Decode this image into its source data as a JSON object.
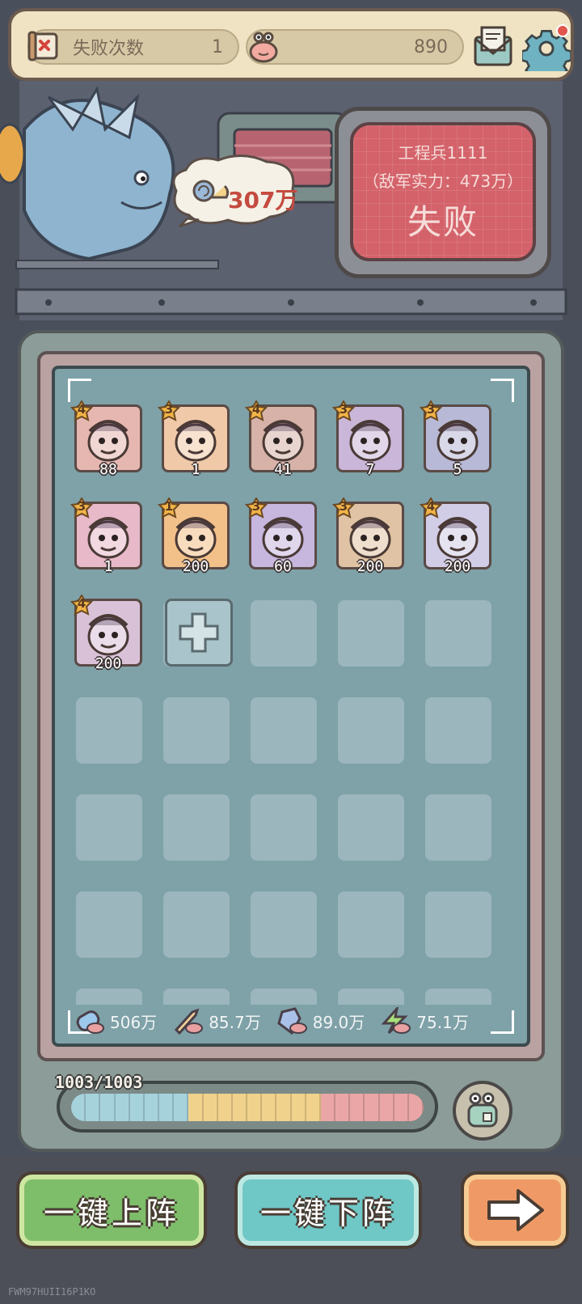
{
  "header": {
    "fail_label": "失败次数",
    "fail_count": "1",
    "snail_value": "890",
    "icons": {
      "fail": "failure-scroll-icon",
      "snail": "snail-currency-icon",
      "mail": "mail-icon",
      "settings": "gear-icon"
    },
    "settings_notification": true
  },
  "battle": {
    "player_power": "307万",
    "enemy_name": "工程兵1111",
    "enemy_power": "（敌军实力：473万）",
    "result": "失败"
  },
  "units": [
    {
      "level": "4",
      "count": "88",
      "color": "#e6b7b0"
    },
    {
      "level": "3",
      "count": "1",
      "color": "#f0c9a8"
    },
    {
      "level": "4",
      "count": "41",
      "color": "#d6b2a8"
    },
    {
      "level": "3",
      "count": "7",
      "color": "#c9b6d8"
    },
    {
      "level": "3",
      "count": "5",
      "color": "#b8b9d6"
    },
    {
      "level": "3",
      "count": "1",
      "color": "#e7b9c9"
    },
    {
      "level": "1",
      "count": "200",
      "color": "#f2c089"
    },
    {
      "level": "3",
      "count": "60",
      "color": "#c7b6de"
    },
    {
      "level": "3",
      "count": "200",
      "color": "#e0c3a4"
    },
    {
      "level": "4",
      "count": "200",
      "color": "#d2cde6"
    },
    {
      "level": "4",
      "count": "200",
      "color": "#d9c2d8"
    }
  ],
  "stats": [
    {
      "icon": "potion-icon",
      "value": "506万"
    },
    {
      "icon": "sword-icon",
      "value": "85.7万"
    },
    {
      "icon": "shield-icon",
      "value": "89.0万"
    },
    {
      "icon": "lightning-icon",
      "value": "75.1万"
    }
  ],
  "capacity": {
    "label": "1003/1003",
    "fill_fraction": 1.0,
    "segment_colors": [
      "#a6d2dc",
      "#a6d2dc",
      "#a6d2dc",
      "#a6d2dc",
      "#a6d2dc",
      "#a6d2dc",
      "#a6d2dc",
      "#a6d2dc",
      "#f1d28c",
      "#f1d28c",
      "#f1d28c",
      "#f1d28c",
      "#f1d28c",
      "#f1d28c",
      "#f1d28c",
      "#f1d28c",
      "#f1d28c",
      "#eaa6a6",
      "#eaa6a6",
      "#eaa6a6",
      "#eaa6a6",
      "#eaa6a6",
      "#eaa6a6",
      "#eaa6a6"
    ]
  },
  "buttons": {
    "deploy": "一键上阵",
    "undeploy": "一键下阵",
    "next_icon": "arrow-right-icon"
  },
  "watermark": "FWM97HUII16P1KO"
}
